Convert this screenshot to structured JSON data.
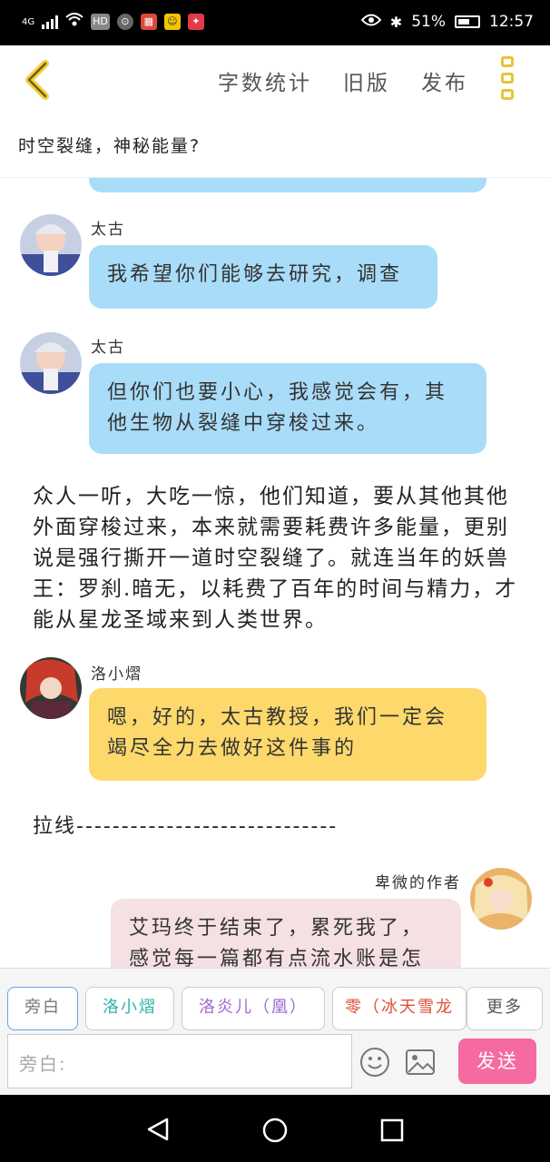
{
  "status_bar": {
    "network": "4G",
    "hd": "HD",
    "battery_percent": "51%",
    "time": "12:57"
  },
  "toolbar": {
    "word_count": "字数统计",
    "old_version": "旧版",
    "publish": "发布"
  },
  "chapter_title": "时空裂缝，神秘能量?",
  "messages": [
    {
      "name": "太古",
      "text": "我希望你们能够去研究，调查"
    },
    {
      "name": "太古",
      "text": "但你们也要小心，我感觉会有，其他生物从裂缝中穿梭过来。"
    }
  ],
  "narration": "众人一听，大吃一惊，他们知道，要从其他其他外面穿梭过来，本来就需要耗费许多能量，更别说是强行撕开一道时空裂缝了。就连当年的妖兽王：罗刹.暗无，以耗费了百年的时间与精力，才能从星龙圣域来到人类世界。",
  "reply": {
    "name": "洛小熠",
    "text": "嗯，好的，太古教授，我们一定会竭尽全力去做好这件事的"
  },
  "pull_line": "拉线-----------------------------",
  "author_message": {
    "name": "卑微的作者",
    "text": "艾玛终于结束了，累死我了，感觉每一篇都有点流水账是怎"
  },
  "role_chips": [
    {
      "label": "旁白",
      "color": "#888888"
    },
    {
      "label": "洛小熠",
      "color": "#2fb3a8"
    },
    {
      "label": "洛炎儿（凰）",
      "color": "#a06ad0"
    },
    {
      "label": "零（冰天雪龙",
      "color": "#e0503a"
    },
    {
      "label": "更多",
      "color": "#555555"
    }
  ],
  "input": {
    "placeholder": "旁白:"
  },
  "send_label": "发送"
}
